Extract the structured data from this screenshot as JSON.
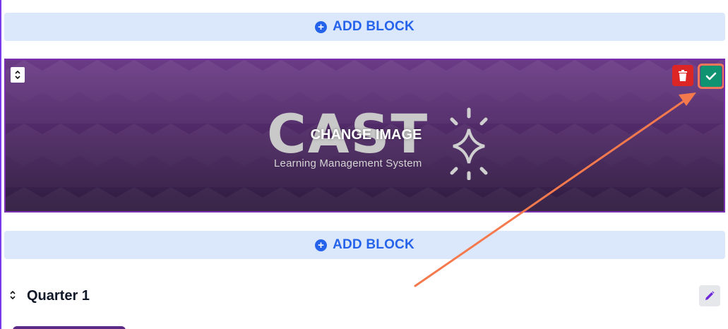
{
  "add_block_top": {
    "label": "ADD BLOCK",
    "icon": "plus-circle-icon"
  },
  "banner": {
    "logo_text": "CAST",
    "logo_subtitle": "Learning Management System",
    "overlay_label": "CHANGE IMAGE",
    "delete_icon": "trash-icon",
    "confirm_icon": "check-icon",
    "colors": {
      "delete": "#dc2626",
      "confirm": "#0f9370",
      "highlight": "#f0785a"
    }
  },
  "add_block_bottom": {
    "label": "ADD BLOCK",
    "icon": "plus-circle-icon"
  },
  "section": {
    "title": "Quarter 1",
    "edit_icon": "pencil-icon"
  },
  "colors": {
    "accent": "#2563eb",
    "add_block_bg": "#dbe7fb",
    "banner_border": "#7b2fb0"
  }
}
